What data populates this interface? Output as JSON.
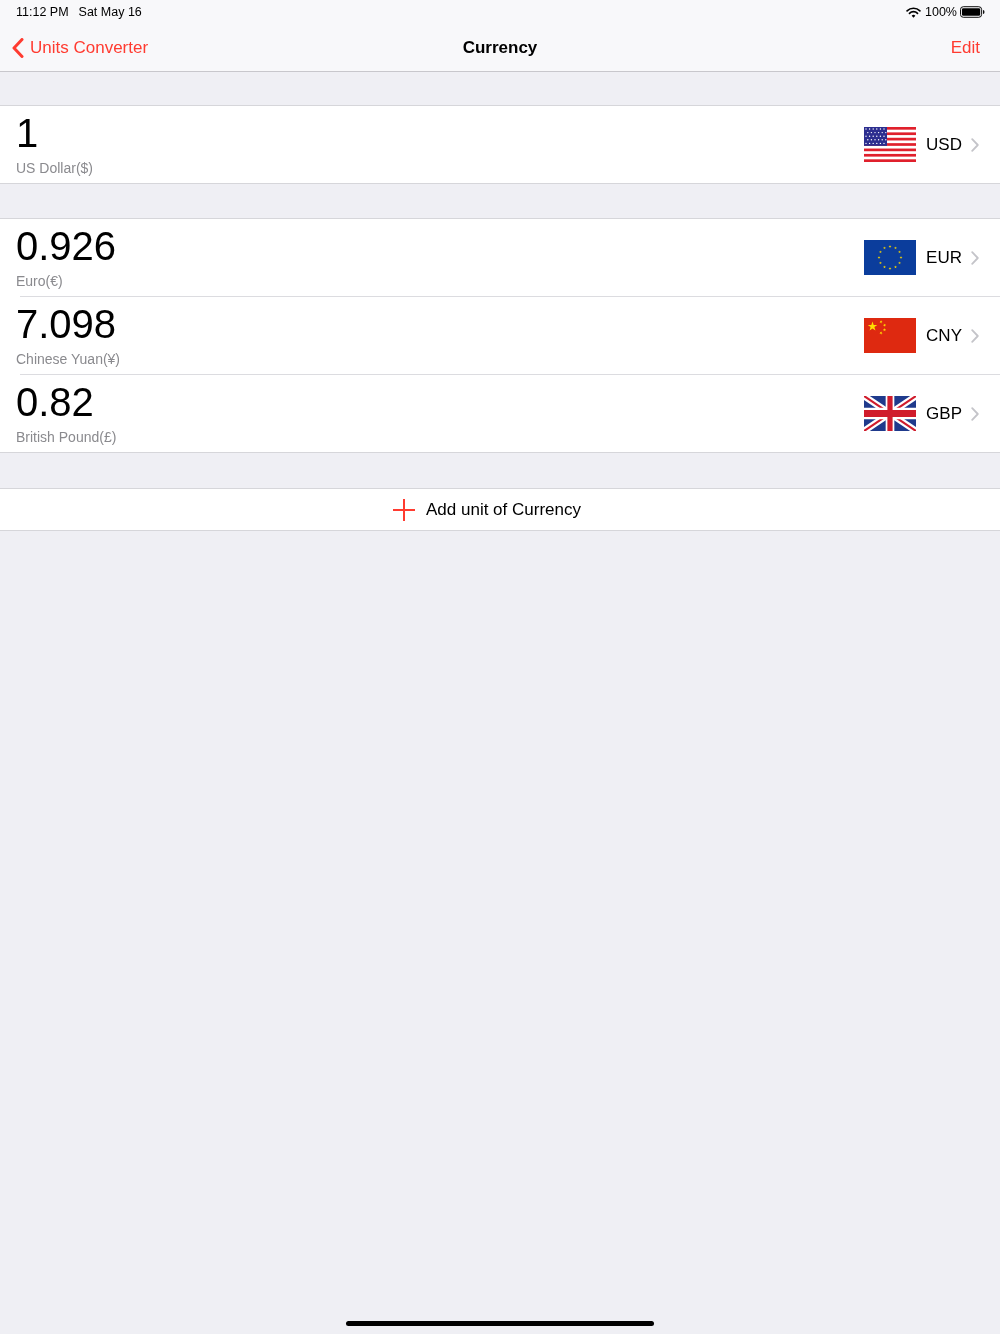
{
  "status_bar": {
    "time": "11:12 PM",
    "date": "Sat May 16",
    "battery": "100%"
  },
  "nav_bar": {
    "back": "Units Converter",
    "title": "Currency",
    "edit": "Edit"
  },
  "base": {
    "value": "1",
    "name": "US Dollar($)",
    "code": "USD",
    "kind": "us"
  },
  "conversions": [
    {
      "value": "0.926",
      "name": "Euro(€)",
      "code": "EUR",
      "kind": "eu"
    },
    {
      "value": "7.098",
      "name": "Chinese Yuan(¥)",
      "code": "CNY",
      "kind": "cn"
    },
    {
      "value": "0.82",
      "name": "British Pound(£)",
      "code": "GBP",
      "kind": "uk"
    }
  ],
  "add_button": {
    "label": "Add unit of Currency"
  }
}
